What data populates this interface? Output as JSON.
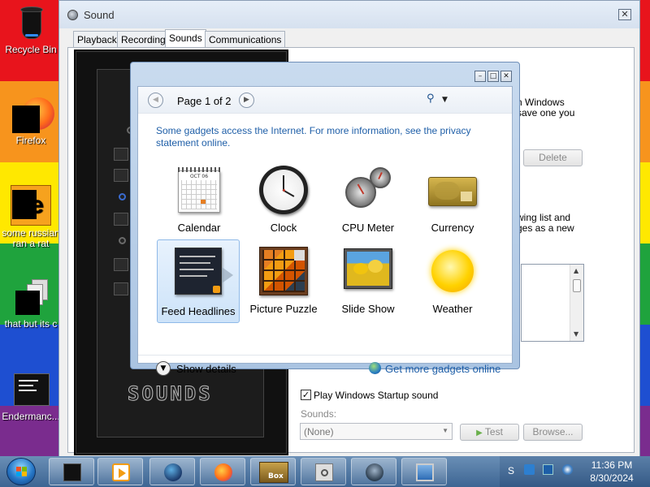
{
  "desktop": {
    "icons": [
      {
        "label": "Recycle Bin",
        "icon": "recycle-bin-icon"
      },
      {
        "label": "Firefox",
        "icon": "firefox-icon"
      },
      {
        "label": "some russian ran a rat",
        "icon": "document-icon"
      },
      {
        "label": "that but its c",
        "icon": "files-icon"
      },
      {
        "label": "Endermanc...",
        "icon": "terminal-icon"
      }
    ]
  },
  "sound_window": {
    "title": "Sound",
    "tabs": [
      {
        "label": "Playback"
      },
      {
        "label": "Recording"
      },
      {
        "label": "Sounds",
        "active": true
      },
      {
        "label": "Communications"
      }
    ],
    "text_fragment_1": "n Windows",
    "text_fragment_2": "save one you",
    "text_fragment_3": "wing list and",
    "text_fragment_4": "ges as a new",
    "delete_label": "Delete",
    "startup_sound_label": "Play Windows Startup sound",
    "startup_sound_checked": true,
    "sounds_label": "Sounds:",
    "sounds_value": "(None)",
    "test_label": "Test",
    "browse_label": "Browse...",
    "skin_logo": "SOUNDS"
  },
  "gadget_gallery": {
    "page_label": "Page 1 of 2",
    "info_text": "Some gadgets access the Internet.  For more information, see the privacy statement online.",
    "gadgets": [
      {
        "name": "Calendar",
        "icon": "calendar-icon"
      },
      {
        "name": "Clock",
        "icon": "clock-icon"
      },
      {
        "name": "CPU Meter",
        "icon": "cpu-meter-icon"
      },
      {
        "name": "Currency",
        "icon": "currency-icon"
      },
      {
        "name": "Feed Headlines",
        "icon": "feed-headlines-icon",
        "selected": true
      },
      {
        "name": "Picture Puzzle",
        "icon": "picture-puzzle-icon"
      },
      {
        "name": "Slide Show",
        "icon": "slide-show-icon"
      },
      {
        "name": "Weather",
        "icon": "weather-icon"
      }
    ],
    "calendar_month": "OCT 06",
    "show_details_label": "Show details",
    "more_gadgets_label": "Get more gadgets online"
  },
  "taskbar": {
    "time": "11:36 PM",
    "date": "8/30/2024",
    "tray_letter": "S",
    "buttons": [
      {
        "icon": "device-icon"
      },
      {
        "icon": "media-player-icon"
      },
      {
        "icon": "globe-app-icon"
      },
      {
        "icon": "firefox-icon"
      },
      {
        "icon": "game-box-icon",
        "label": "Box"
      },
      {
        "icon": "sound-settings-icon"
      },
      {
        "icon": "gadgets-icon"
      },
      {
        "icon": "display-icon"
      }
    ]
  },
  "colors": {
    "link_blue": "#1f5fa8",
    "taskbar": "#3d6593"
  }
}
